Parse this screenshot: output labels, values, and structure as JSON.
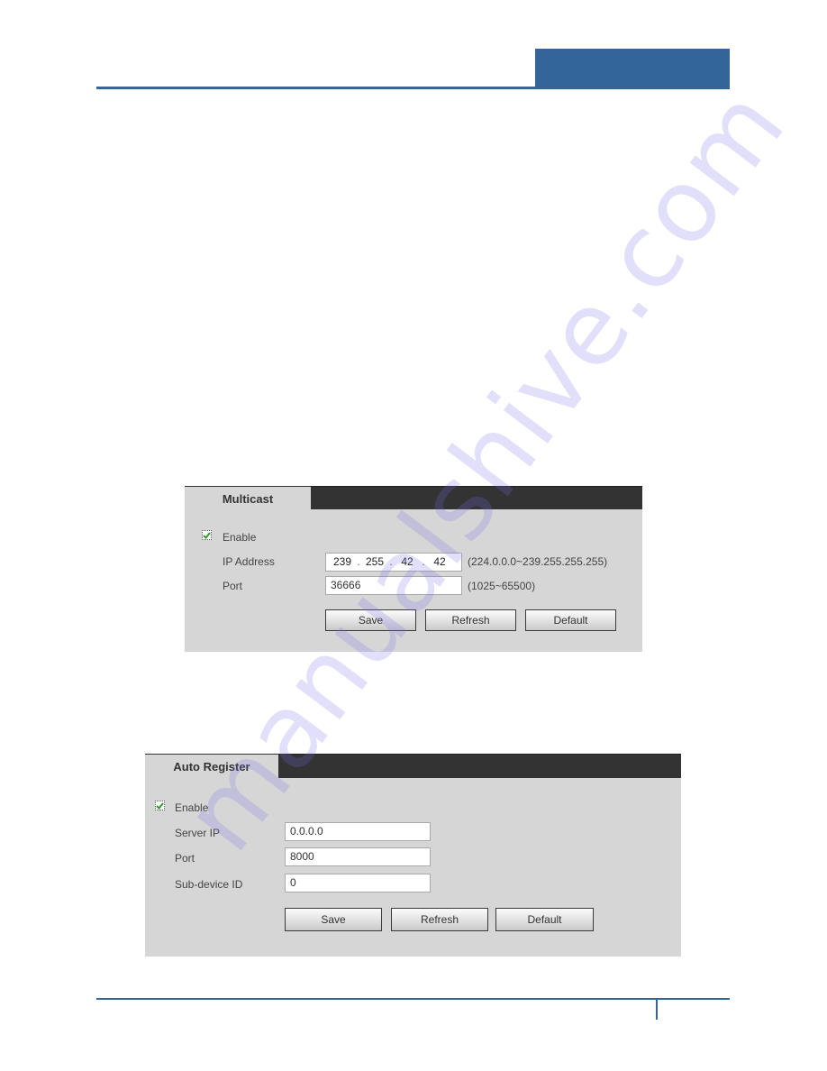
{
  "page": {
    "watermark": "manualshive.com"
  },
  "multicast": {
    "tab_title": "Multicast",
    "enable": {
      "label": "Enable",
      "checked": true
    },
    "ip_address": {
      "label": "IP Address",
      "octets": [
        "239",
        "255",
        "42",
        "42"
      ],
      "separator": ".",
      "range_hint": "(224.0.0.0~239.255.255.255)"
    },
    "port": {
      "label": "Port",
      "value": "36666",
      "range_hint": "(1025~65500)"
    },
    "buttons": {
      "save": "Save",
      "refresh": "Refresh",
      "default": "Default"
    }
  },
  "auto_register": {
    "tab_title": "Auto Register",
    "enable": {
      "label": "Enable",
      "checked": true
    },
    "server_ip": {
      "label": "Server IP",
      "value": "0.0.0.0"
    },
    "port": {
      "label": "Port",
      "value": "8000"
    },
    "sub_device_id": {
      "label": "Sub-device ID",
      "value": "0"
    },
    "buttons": {
      "save": "Save",
      "refresh": "Refresh",
      "default": "Default"
    }
  },
  "colors": {
    "brand_blue": "#33659a",
    "panel_bg": "#d6d6d6",
    "tab_bar": "#333333",
    "check_green": "#2e9b2e"
  }
}
